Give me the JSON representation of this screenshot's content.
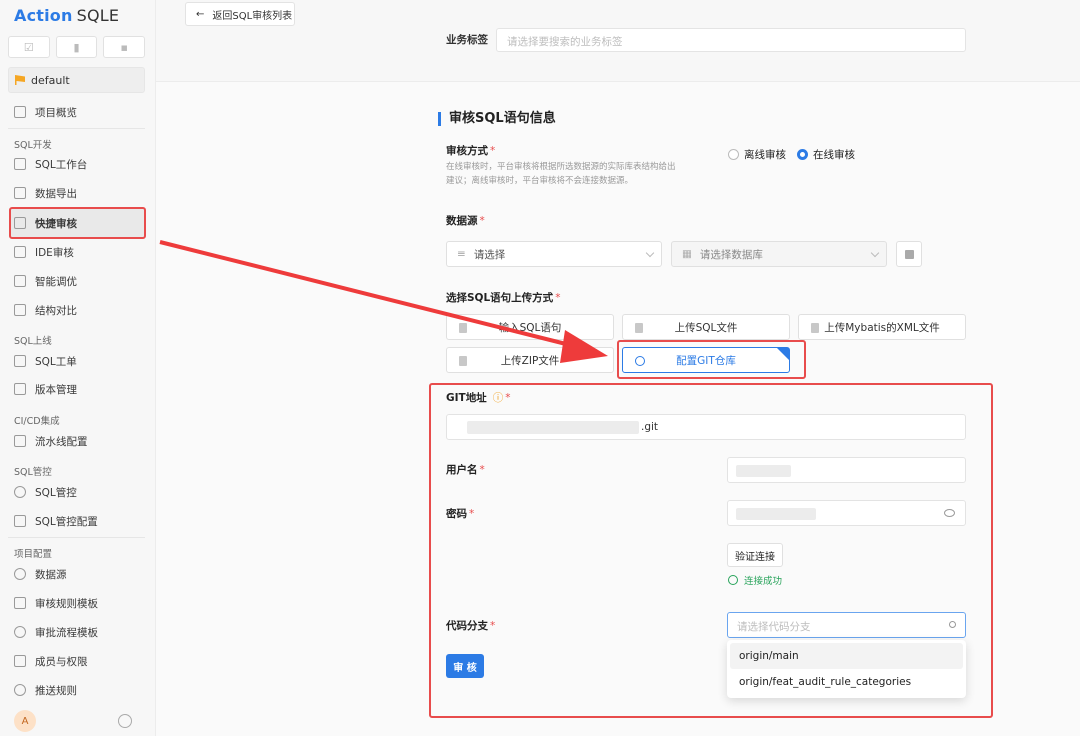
{
  "app": {
    "brand_a": "Action",
    "brand_b": "SQLE"
  },
  "project": {
    "name": "default"
  },
  "sidebar": {
    "overview": "项目概览",
    "sections": [
      "SQL开发",
      "SQL上线",
      "CI/CD集成",
      "SQL管控",
      "项目配置"
    ],
    "items": [
      "SQL工作台",
      "数据导出",
      "快捷审核",
      "IDE审核",
      "智能调优",
      "结构对比",
      "SQL工单",
      "版本管理",
      "流水线配置",
      "SQL管控",
      "SQL管控配置",
      "数据源",
      "审核规则模板",
      "审批流程模板",
      "成员与权限",
      "推送规则"
    ],
    "avatar": "A"
  },
  "header": {
    "back_button": "返回SQL审核列表",
    "biz_tag_label": "业务标签",
    "biz_tag_placeholder": "请选择要搜索的业务标签"
  },
  "form": {
    "section_title": "审核SQL语句信息",
    "audit_mode_label": "审核方式",
    "audit_mode_help": "在线审核时，平台审核将根据所选数据源的实际库表结构给出建议；离线审核时，平台审核将不会连接数据源。",
    "mode_offline": "离线审核",
    "mode_online": "在线审核",
    "datasource_label": "数据源",
    "datasource_placeholder": "请选择",
    "database_placeholder": "请选择数据库",
    "upload_label": "选择SQL语句上传方式",
    "upload_options": [
      "输入SQL语句",
      "上传SQL文件",
      "上传Mybatis的XML文件",
      "上传ZIP文件",
      "配置GIT仓库"
    ],
    "git_label": "GIT地址",
    "git_value_suffix": ".git",
    "username_label": "用户名",
    "password_label": "密码",
    "verify_button": "验证连接",
    "verify_status": "连接成功",
    "branch_label": "代码分支",
    "branch_placeholder": "请选择代码分支",
    "branch_options": [
      "origin/main",
      "origin/feat_audit_rule_categories"
    ],
    "submit_button": "审 核",
    "required_mark": "*"
  },
  "colors": {
    "accent": "#2c7be5",
    "annotation": "#e84c4c",
    "success": "#27a35a"
  }
}
